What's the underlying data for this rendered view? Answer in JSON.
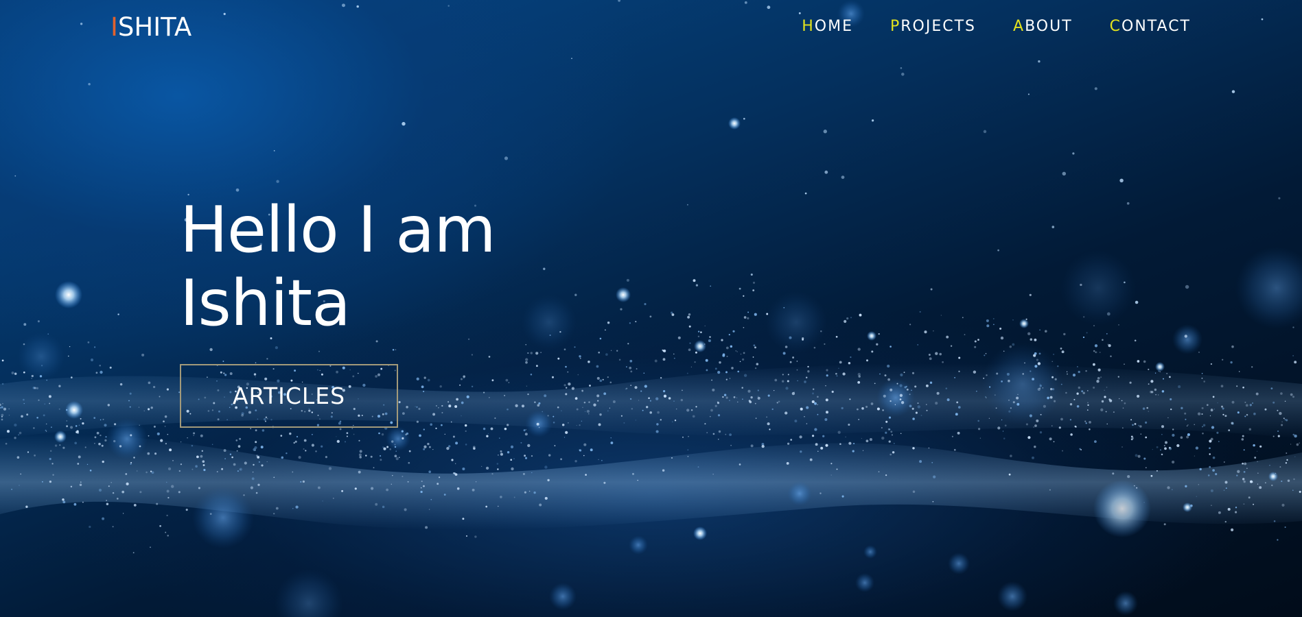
{
  "nav": {
    "logo": {
      "accent": "I",
      "rest": "SHITA"
    },
    "items": [
      {
        "initial": "H",
        "rest": "OME"
      },
      {
        "initial": "P",
        "rest": "ROJECTS"
      },
      {
        "initial": "A",
        "rest": "BOUT"
      },
      {
        "initial": "C",
        "rest": "ONTACT"
      }
    ]
  },
  "hero": {
    "headline_line1": "Hello I am",
    "headline_line2": "Ishita",
    "cta_label": "ARTICLES",
    "background": "blue-particle-bokeh-image"
  },
  "colors": {
    "logo_accent": "#e0622e",
    "nav_initial": "#e3e31e",
    "text": "#ffffff",
    "button_border": "#a39a7a",
    "background_deep": "#021a33",
    "background_light": "#064a8c"
  }
}
